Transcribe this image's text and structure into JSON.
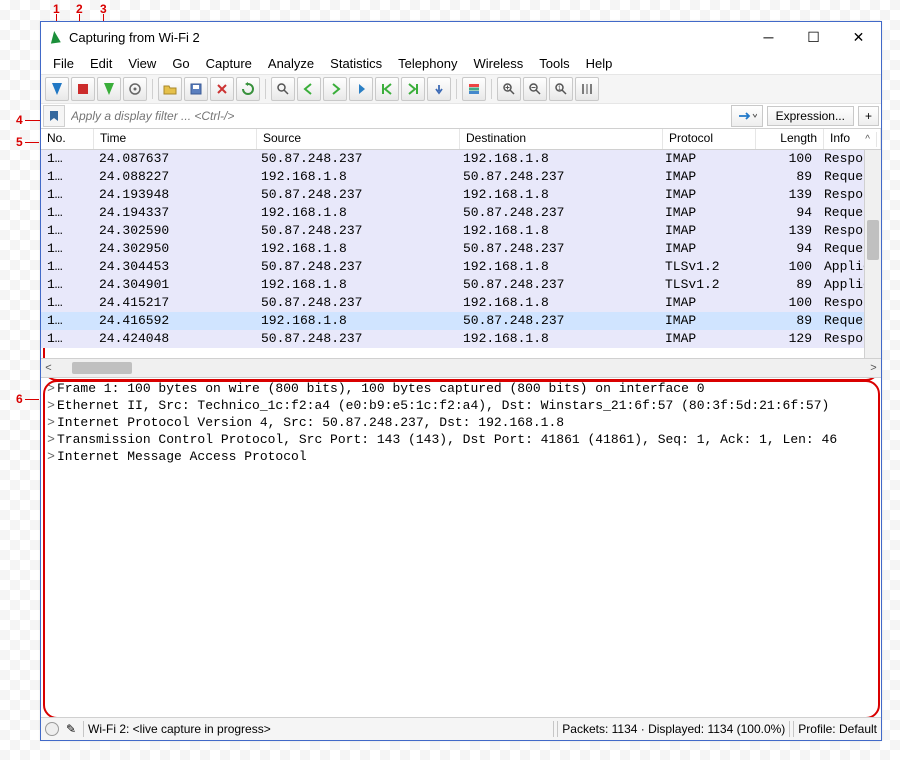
{
  "annotations": {
    "n1": "1",
    "n2": "2",
    "n3": "3",
    "n4": "4",
    "n5": "5",
    "n6": "6"
  },
  "title": "Capturing from Wi-Fi 2",
  "menu": [
    "File",
    "Edit",
    "View",
    "Go",
    "Capture",
    "Analyze",
    "Statistics",
    "Telephony",
    "Wireless",
    "Tools",
    "Help"
  ],
  "filter": {
    "placeholder": "Apply a display filter ... <Ctrl-/>",
    "expression": "Expression...",
    "plus": "+"
  },
  "columns": {
    "no": "No.",
    "time": "Time",
    "src": "Source",
    "dst": "Destination",
    "proto": "Protocol",
    "len": "Length",
    "info": "Info"
  },
  "packets": [
    {
      "no": "1…",
      "time": "24.087637",
      "src": "50.87.248.237",
      "dst": "192.168.1.8",
      "proto": "IMAP",
      "len": "100",
      "info": "Response:"
    },
    {
      "no": "1…",
      "time": "24.088227",
      "src": "192.168.1.8",
      "dst": "50.87.248.237",
      "proto": "IMAP",
      "len": "89",
      "info": "Request:"
    },
    {
      "no": "1…",
      "time": "24.193948",
      "src": "50.87.248.237",
      "dst": "192.168.1.8",
      "proto": "IMAP",
      "len": "139",
      "info": "Response:"
    },
    {
      "no": "1…",
      "time": "24.194337",
      "src": "192.168.1.8",
      "dst": "50.87.248.237",
      "proto": "IMAP",
      "len": "94",
      "info": "Request:"
    },
    {
      "no": "1…",
      "time": "24.302590",
      "src": "50.87.248.237",
      "dst": "192.168.1.8",
      "proto": "IMAP",
      "len": "139",
      "info": "Response:"
    },
    {
      "no": "1…",
      "time": "24.302950",
      "src": "192.168.1.8",
      "dst": "50.87.248.237",
      "proto": "IMAP",
      "len": "94",
      "info": "Request:"
    },
    {
      "no": "1…",
      "time": "24.304453",
      "src": "50.87.248.237",
      "dst": "192.168.1.8",
      "proto": "TLSv1.2",
      "len": "100",
      "info": "Applicati"
    },
    {
      "no": "1…",
      "time": "24.304901",
      "src": "192.168.1.8",
      "dst": "50.87.248.237",
      "proto": "TLSv1.2",
      "len": "89",
      "info": "Applicati"
    },
    {
      "no": "1…",
      "time": "24.415217",
      "src": "50.87.248.237",
      "dst": "192.168.1.8",
      "proto": "IMAP",
      "len": "100",
      "info": "Response:"
    },
    {
      "no": "1…",
      "time": "24.416592",
      "src": "192.168.1.8",
      "dst": "50.87.248.237",
      "proto": "IMAP",
      "len": "89",
      "info": "Request:",
      "sel": true
    },
    {
      "no": "1…",
      "time": "24.424048",
      "src": "50.87.248.237",
      "dst": "192.168.1.8",
      "proto": "IMAP",
      "len": "129",
      "info": "Response:"
    }
  ],
  "details": [
    "Frame 1: 100 bytes on wire (800 bits), 100 bytes captured (800 bits) on interface 0",
    "Ethernet II, Src: Technico_1c:f2:a4 (e0:b9:e5:1c:f2:a4), Dst: Winstars_21:6f:57 (80:3f:5d:21:6f:57)",
    "Internet Protocol Version 4, Src: 50.87.248.237, Dst: 192.168.1.8",
    "Transmission Control Protocol, Src Port: 143 (143), Dst Port: 41861 (41861), Seq: 1, Ack: 1, Len: 46",
    "Internet Message Access Protocol"
  ],
  "status": {
    "capture": "Wi-Fi 2: <live capture in progress>",
    "packets": "Packets: 1134 · Displayed: 1134 (100.0%)",
    "profile": "Profile: Default"
  }
}
